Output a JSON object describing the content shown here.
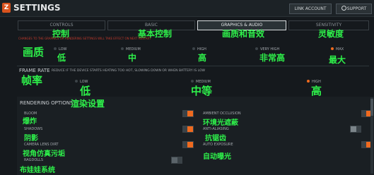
{
  "app": {
    "title": "SETTINGS",
    "logo": "Z"
  },
  "header": {
    "link_account": "LINK ACCOUNT",
    "support": "SUPPORT"
  },
  "tabs": [
    {
      "label": "CONTROLS",
      "cn": "控制"
    },
    {
      "label": "BASIC",
      "cn": "基本控制"
    },
    {
      "label": "GRAPHICS & AUDIO",
      "cn": "画质和音效",
      "active": true
    },
    {
      "label": "SENSITIVITY",
      "cn": "灵敏度"
    }
  ],
  "warning": "CHANGES TO THE GRAPHICS OR RENDERING SETTINGS WILL TAKE EFFECT ON NEXT RESTART",
  "quality": {
    "cn_title": "画质",
    "options": [
      {
        "label": "LOW",
        "cn": "低",
        "selected": false
      },
      {
        "label": "MEDIUM",
        "cn": "中",
        "selected": false
      },
      {
        "label": "HIGH",
        "cn": "高",
        "selected": false
      },
      {
        "label": "VERY HIGH",
        "cn": "非常高",
        "selected": false
      },
      {
        "label": "MAX",
        "cn": "最大",
        "selected": true
      }
    ]
  },
  "frame_rate": {
    "title": "FRAME RATE",
    "cn_title": "帧率",
    "note": "REDUCE IF THE DEVICE STARTS HEATING TOO HOT, SLOWING DOWN OR WHEN BATTERY IS LOW",
    "options": [
      {
        "label": "LOW",
        "cn": "低",
        "selected": false
      },
      {
        "label": "MEDIUM",
        "cn": "中等",
        "selected": false
      },
      {
        "label": "HIGH",
        "cn": "高",
        "selected": true
      }
    ]
  },
  "rendering": {
    "title": "RENDERING OPTIONS",
    "cn_title": "渲染设置",
    "items": [
      {
        "label": "BLOOM",
        "cn": "爆炸",
        "on": true
      },
      {
        "label": "AMBIENT OCCLUSION",
        "cn": "环境光遮蔽",
        "on": true
      },
      {
        "label": "SHADOWS",
        "cn": "阴影",
        "on": true
      },
      {
        "label": "ANTI-ALIASING",
        "cn": "抗锯齿",
        "on": false
      },
      {
        "label": "CAMERA LENS DIRT",
        "cn": "视角仿真污垢",
        "on": true
      },
      {
        "label": "AUTO EXPOSURE",
        "cn": "自动曝光",
        "on": true
      },
      {
        "label": "RAGDOLLS",
        "cn": "布娃娃系统",
        "on": false
      }
    ]
  },
  "colors": {
    "accent": "#ef6a1f",
    "annotation": "#2ef04a",
    "warning": "#c0392b"
  }
}
